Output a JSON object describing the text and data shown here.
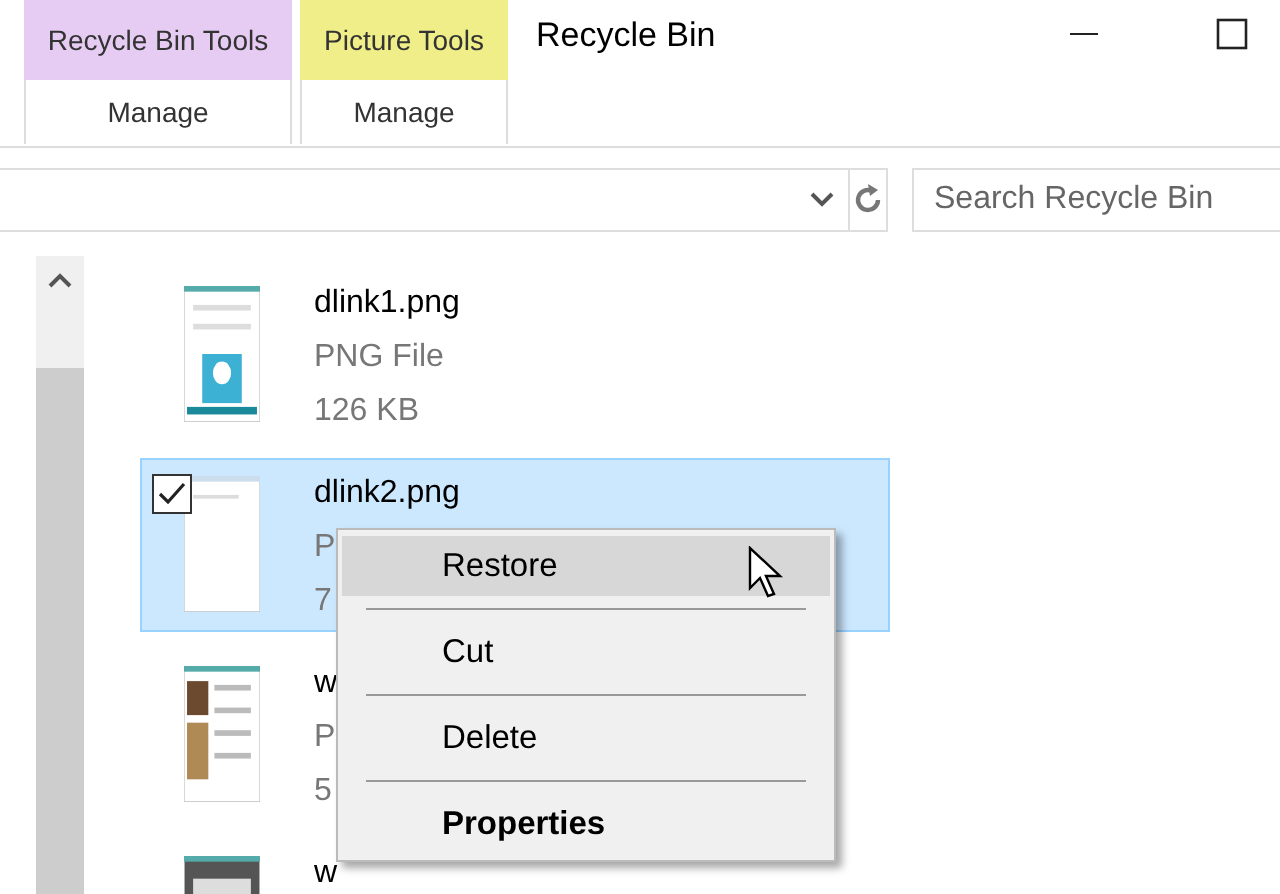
{
  "window": {
    "title": "Recycle Bin"
  },
  "ribbon_groups": [
    {
      "title": "Recycle Bin Tools",
      "color": "#e6cbf3",
      "tab": "Manage"
    },
    {
      "title": "Picture Tools",
      "color": "#f0ee88",
      "tab": "Manage"
    }
  ],
  "search": {
    "placeholder": "Search Recycle Bin"
  },
  "files": [
    {
      "name": "dlink1.png",
      "type": "PNG File",
      "size": "126 KB",
      "selected": false,
      "checked": false
    },
    {
      "name": "dlink2.png",
      "type": "P",
      "size": "7",
      "selected": true,
      "checked": true
    },
    {
      "name": "w",
      "type": "P",
      "size": "5",
      "selected": false,
      "checked": false
    },
    {
      "name": "w",
      "selected": false,
      "checked": false
    }
  ],
  "context_menu": [
    {
      "label": "Restore",
      "selected": true,
      "default": false
    },
    {
      "label": "Cut",
      "selected": false,
      "default": false
    },
    {
      "label": "Delete",
      "selected": false,
      "default": false
    },
    {
      "label": "Properties",
      "selected": false,
      "default": true
    }
  ]
}
